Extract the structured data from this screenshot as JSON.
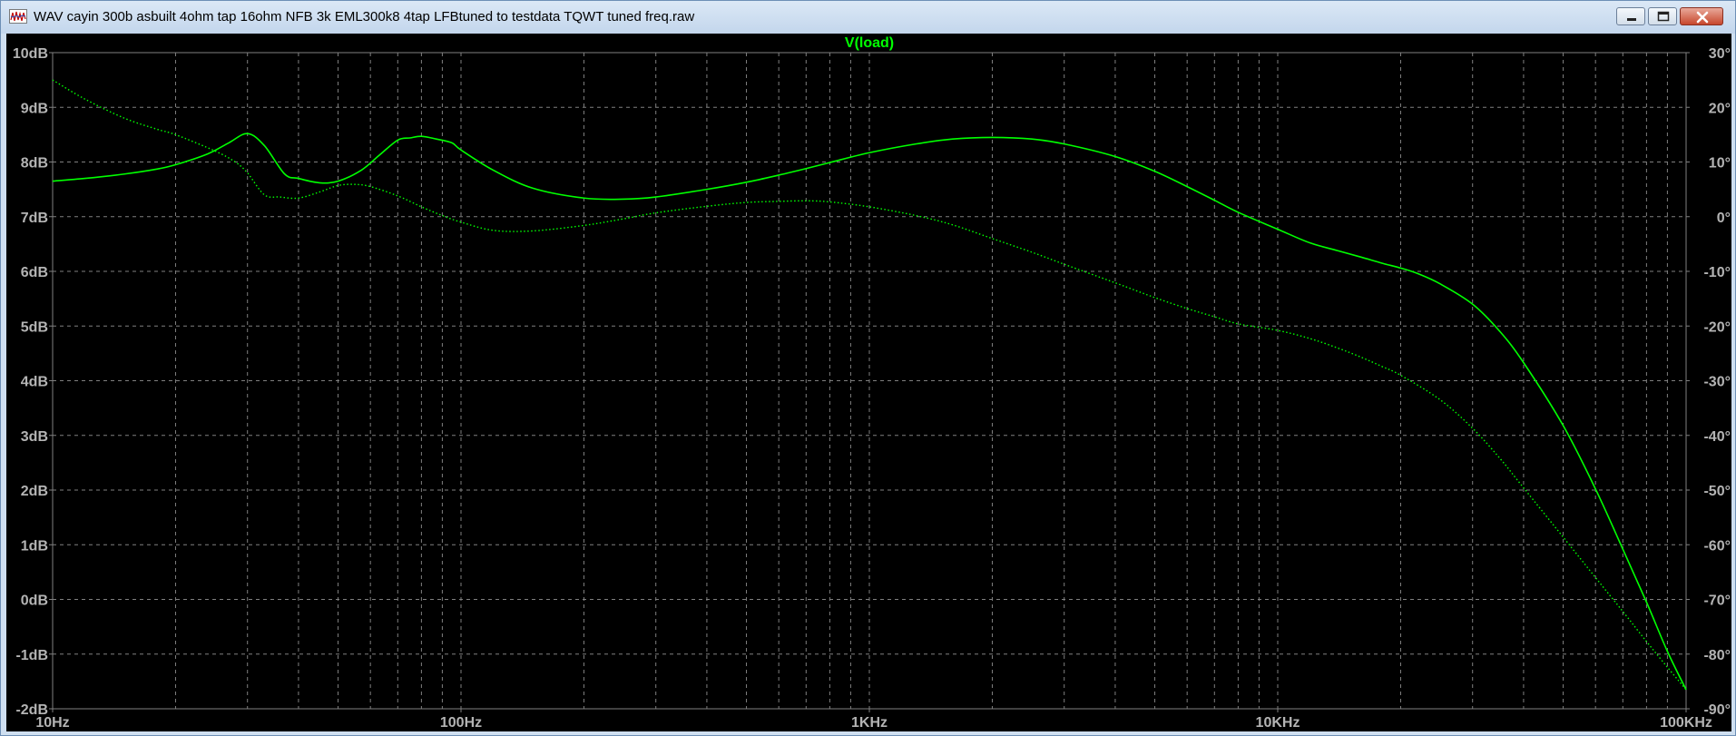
{
  "window": {
    "title": "WAV cayin 300b asbuilt 4ohm tap 16ohm NFB 3k EML300k8 4tap LFBtuned to testdata TQWT tuned freq.raw",
    "icons": {
      "app": "waveform-app-icon",
      "minimize": "minimize-icon",
      "maximize": "maximize-icon",
      "close": "close-icon"
    }
  },
  "colors": {
    "background": "#000000",
    "grid": "#808080",
    "trace": "#00ff00",
    "tick_text": "#b4b4b4"
  },
  "chart_data": {
    "type": "line",
    "title": "V(load)",
    "xscale": "log",
    "xlim": [
      10,
      100000
    ],
    "x_ticks": [
      {
        "value": 10,
        "label": "10Hz"
      },
      {
        "value": 100,
        "label": "100Hz"
      },
      {
        "value": 1000,
        "label": "1KHz"
      },
      {
        "value": 10000,
        "label": "10KHz"
      },
      {
        "value": 100000,
        "label": "100KHz"
      }
    ],
    "ylim_left": [
      -2,
      10
    ],
    "y_ticks_left": [
      "10dB",
      "9dB",
      "8dB",
      "7dB",
      "6dB",
      "5dB",
      "4dB",
      "3dB",
      "2dB",
      "1dB",
      "0dB",
      "-1dB",
      "-2dB"
    ],
    "ylim_right": [
      -90,
      30
    ],
    "y_ticks_right": [
      "30°",
      "20°",
      "10°",
      "0°",
      "-10°",
      "-20°",
      "-30°",
      "-40°",
      "-50°",
      "-60°",
      "-70°",
      "-80°",
      "-90°"
    ],
    "grid": true,
    "series": [
      {
        "axis": "left",
        "style": "solid",
        "x": [
          10,
          12,
          15,
          18,
          20,
          24,
          27,
          30,
          33,
          37,
          40,
          45,
          50,
          57,
          63,
          70,
          75,
          80,
          87,
          95,
          100,
          120,
          150,
          200,
          250,
          300,
          400,
          500,
          600,
          700,
          800,
          1000,
          1300,
          1600,
          2000,
          2500,
          3000,
          4000,
          5000,
          6000,
          7000,
          8000,
          10000,
          12000,
          14000,
          16000,
          18000,
          20000,
          22000,
          25000,
          30000,
          35000,
          40000,
          50000,
          60000,
          70000,
          80000,
          90000,
          100000
        ],
        "values": [
          7.65,
          7.7,
          7.78,
          7.87,
          7.95,
          8.15,
          8.35,
          8.52,
          8.3,
          7.78,
          7.7,
          7.62,
          7.65,
          7.85,
          8.12,
          8.4,
          8.44,
          8.47,
          8.42,
          8.35,
          8.22,
          7.85,
          7.52,
          7.34,
          7.32,
          7.36,
          7.5,
          7.63,
          7.76,
          7.88,
          7.99,
          8.17,
          8.33,
          8.42,
          8.45,
          8.42,
          8.33,
          8.1,
          7.83,
          7.55,
          7.3,
          7.08,
          6.77,
          6.52,
          6.38,
          6.26,
          6.15,
          6.06,
          5.96,
          5.77,
          5.4,
          4.9,
          4.33,
          3.18,
          2.02,
          0.92,
          -0.05,
          -0.95,
          -1.65
        ]
      },
      {
        "axis": "right",
        "style": "dotted",
        "x": [
          10,
          12,
          15,
          18,
          20,
          25,
          28,
          30,
          33,
          36,
          40,
          45,
          50,
          55,
          60,
          70,
          80,
          90,
          100,
          120,
          150,
          200,
          250,
          300,
          400,
          500,
          600,
          700,
          800,
          1000,
          1300,
          1600,
          2000,
          2500,
          3000,
          4000,
          5000,
          6000,
          7000,
          8000,
          10000,
          12000,
          14000,
          16000,
          18000,
          20000,
          25000,
          30000,
          35000,
          40000,
          50000,
          60000,
          70000,
          80000,
          90000,
          100000
        ],
        "values": [
          25,
          21.5,
          18,
          16,
          15,
          12,
          10,
          8,
          4,
          3.6,
          3.4,
          4.5,
          5.7,
          5.9,
          5.5,
          3.8,
          1.8,
          0.2,
          -1,
          -2.5,
          -2.6,
          -1.6,
          -0.4,
          0.7,
          1.9,
          2.6,
          2.8,
          2.9,
          2.7,
          1.8,
          0.2,
          -1.5,
          -4,
          -6.5,
          -8.7,
          -12.1,
          -14.8,
          -16.8,
          -18.3,
          -19.6,
          -20.8,
          -22.3,
          -24,
          -25.7,
          -27.4,
          -29,
          -33.5,
          -38.7,
          -44.2,
          -49.6,
          -58.6,
          -66,
          -72.2,
          -77.7,
          -82.4,
          -86.5
        ]
      }
    ]
  }
}
